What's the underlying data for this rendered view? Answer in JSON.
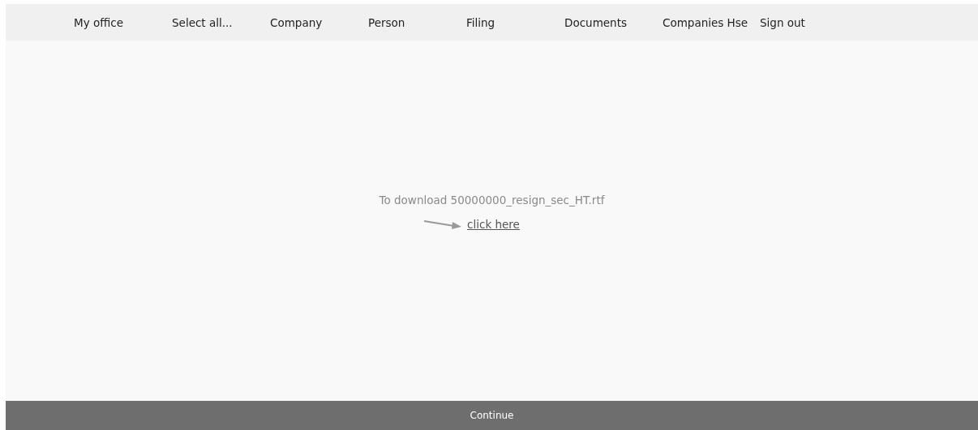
{
  "nav": {
    "items": [
      "My office",
      "Select all...",
      "Company",
      "Person",
      "Filing",
      "Documents",
      "Companies Hse",
      "Sign out"
    ]
  },
  "download": {
    "message": "To download 50000000_resign_sec_HT.rtf",
    "link": "click here"
  },
  "footer": {
    "button": "Continue"
  }
}
